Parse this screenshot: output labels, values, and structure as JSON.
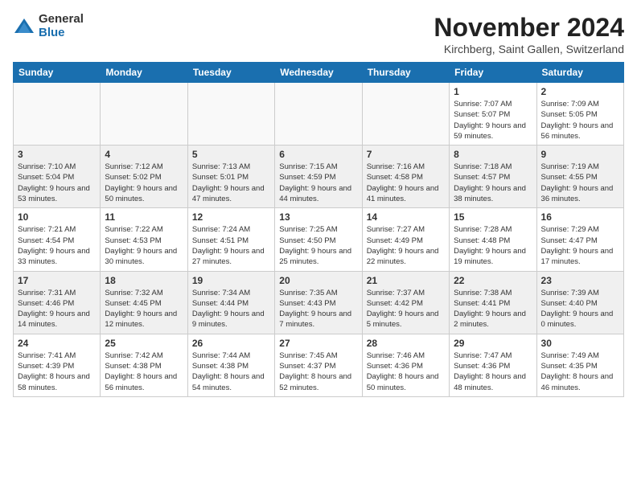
{
  "header": {
    "logo_general": "General",
    "logo_blue": "Blue",
    "month_title": "November 2024",
    "location": "Kirchberg, Saint Gallen, Switzerland"
  },
  "days_of_week": [
    "Sunday",
    "Monday",
    "Tuesday",
    "Wednesday",
    "Thursday",
    "Friday",
    "Saturday"
  ],
  "weeks": [
    {
      "shaded": false,
      "days": [
        {
          "num": "",
          "info": ""
        },
        {
          "num": "",
          "info": ""
        },
        {
          "num": "",
          "info": ""
        },
        {
          "num": "",
          "info": ""
        },
        {
          "num": "",
          "info": ""
        },
        {
          "num": "1",
          "info": "Sunrise: 7:07 AM\nSunset: 5:07 PM\nDaylight: 9 hours and 59 minutes."
        },
        {
          "num": "2",
          "info": "Sunrise: 7:09 AM\nSunset: 5:05 PM\nDaylight: 9 hours and 56 minutes."
        }
      ]
    },
    {
      "shaded": true,
      "days": [
        {
          "num": "3",
          "info": "Sunrise: 7:10 AM\nSunset: 5:04 PM\nDaylight: 9 hours and 53 minutes."
        },
        {
          "num": "4",
          "info": "Sunrise: 7:12 AM\nSunset: 5:02 PM\nDaylight: 9 hours and 50 minutes."
        },
        {
          "num": "5",
          "info": "Sunrise: 7:13 AM\nSunset: 5:01 PM\nDaylight: 9 hours and 47 minutes."
        },
        {
          "num": "6",
          "info": "Sunrise: 7:15 AM\nSunset: 4:59 PM\nDaylight: 9 hours and 44 minutes."
        },
        {
          "num": "7",
          "info": "Sunrise: 7:16 AM\nSunset: 4:58 PM\nDaylight: 9 hours and 41 minutes."
        },
        {
          "num": "8",
          "info": "Sunrise: 7:18 AM\nSunset: 4:57 PM\nDaylight: 9 hours and 38 minutes."
        },
        {
          "num": "9",
          "info": "Sunrise: 7:19 AM\nSunset: 4:55 PM\nDaylight: 9 hours and 36 minutes."
        }
      ]
    },
    {
      "shaded": false,
      "days": [
        {
          "num": "10",
          "info": "Sunrise: 7:21 AM\nSunset: 4:54 PM\nDaylight: 9 hours and 33 minutes."
        },
        {
          "num": "11",
          "info": "Sunrise: 7:22 AM\nSunset: 4:53 PM\nDaylight: 9 hours and 30 minutes."
        },
        {
          "num": "12",
          "info": "Sunrise: 7:24 AM\nSunset: 4:51 PM\nDaylight: 9 hours and 27 minutes."
        },
        {
          "num": "13",
          "info": "Sunrise: 7:25 AM\nSunset: 4:50 PM\nDaylight: 9 hours and 25 minutes."
        },
        {
          "num": "14",
          "info": "Sunrise: 7:27 AM\nSunset: 4:49 PM\nDaylight: 9 hours and 22 minutes."
        },
        {
          "num": "15",
          "info": "Sunrise: 7:28 AM\nSunset: 4:48 PM\nDaylight: 9 hours and 19 minutes."
        },
        {
          "num": "16",
          "info": "Sunrise: 7:29 AM\nSunset: 4:47 PM\nDaylight: 9 hours and 17 minutes."
        }
      ]
    },
    {
      "shaded": true,
      "days": [
        {
          "num": "17",
          "info": "Sunrise: 7:31 AM\nSunset: 4:46 PM\nDaylight: 9 hours and 14 minutes."
        },
        {
          "num": "18",
          "info": "Sunrise: 7:32 AM\nSunset: 4:45 PM\nDaylight: 9 hours and 12 minutes."
        },
        {
          "num": "19",
          "info": "Sunrise: 7:34 AM\nSunset: 4:44 PM\nDaylight: 9 hours and 9 minutes."
        },
        {
          "num": "20",
          "info": "Sunrise: 7:35 AM\nSunset: 4:43 PM\nDaylight: 9 hours and 7 minutes."
        },
        {
          "num": "21",
          "info": "Sunrise: 7:37 AM\nSunset: 4:42 PM\nDaylight: 9 hours and 5 minutes."
        },
        {
          "num": "22",
          "info": "Sunrise: 7:38 AM\nSunset: 4:41 PM\nDaylight: 9 hours and 2 minutes."
        },
        {
          "num": "23",
          "info": "Sunrise: 7:39 AM\nSunset: 4:40 PM\nDaylight: 9 hours and 0 minutes."
        }
      ]
    },
    {
      "shaded": false,
      "days": [
        {
          "num": "24",
          "info": "Sunrise: 7:41 AM\nSunset: 4:39 PM\nDaylight: 8 hours and 58 minutes."
        },
        {
          "num": "25",
          "info": "Sunrise: 7:42 AM\nSunset: 4:38 PM\nDaylight: 8 hours and 56 minutes."
        },
        {
          "num": "26",
          "info": "Sunrise: 7:44 AM\nSunset: 4:38 PM\nDaylight: 8 hours and 54 minutes."
        },
        {
          "num": "27",
          "info": "Sunrise: 7:45 AM\nSunset: 4:37 PM\nDaylight: 8 hours and 52 minutes."
        },
        {
          "num": "28",
          "info": "Sunrise: 7:46 AM\nSunset: 4:36 PM\nDaylight: 8 hours and 50 minutes."
        },
        {
          "num": "29",
          "info": "Sunrise: 7:47 AM\nSunset: 4:36 PM\nDaylight: 8 hours and 48 minutes."
        },
        {
          "num": "30",
          "info": "Sunrise: 7:49 AM\nSunset: 4:35 PM\nDaylight: 8 hours and 46 minutes."
        }
      ]
    }
  ]
}
